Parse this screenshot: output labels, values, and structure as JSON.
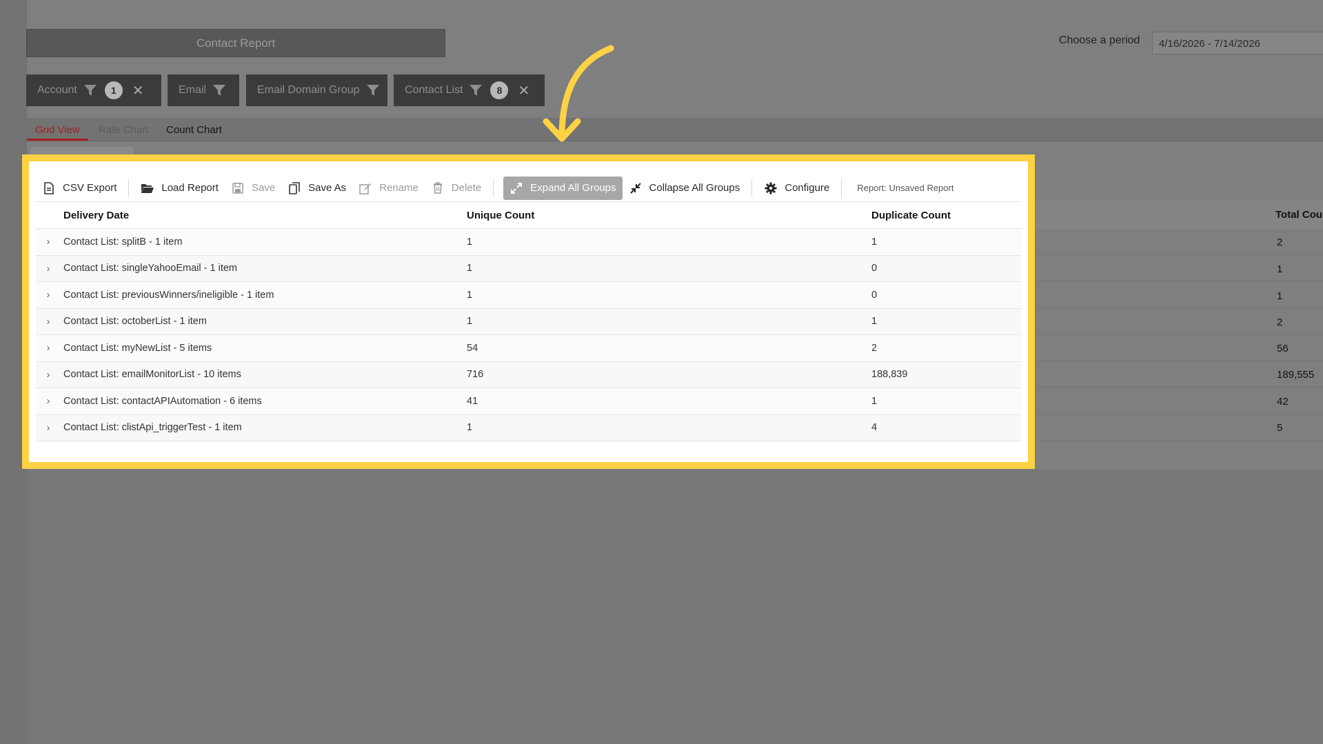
{
  "header": {
    "title": "Contact Report",
    "period_label": "Choose a period",
    "period_value": "4/16/2026 - 7/14/2026"
  },
  "filters": [
    {
      "label": "Account",
      "badge": "1",
      "removable": true
    },
    {
      "label": "Email",
      "badge": null,
      "removable": false
    },
    {
      "label": "Email Domain Group",
      "badge": null,
      "removable": false
    },
    {
      "label": "Contact List",
      "badge": "8",
      "removable": true
    }
  ],
  "filter_icons": {
    "funnel": "filter-funnel-icon",
    "remove": "close-icon",
    "remove_glyph": "✕"
  },
  "tabs": [
    {
      "label": "Grid View",
      "active": true
    },
    {
      "label": "Rate Chart",
      "active": false
    },
    {
      "label": "Count Chart",
      "active": false
    }
  ],
  "toolbar": {
    "csv_export": "CSV Export",
    "load_report": "Load Report",
    "save": "Save",
    "save_as": "Save As",
    "rename": "Rename",
    "delete": "Delete",
    "expand_all": "Expand All Groups",
    "collapse_all": "Collapse All Groups",
    "configure": "Configure",
    "report_name": "Report: Unsaved Report"
  },
  "grid": {
    "columns": {
      "delivery_date": "Delivery Date",
      "unique_count": "Unique Count",
      "duplicate_count": "Duplicate Count",
      "total_count": "Total Cou"
    },
    "rows": [
      {
        "name": "Contact List: splitB - 1 item",
        "unique": "1",
        "duplicate": "1",
        "total": "2"
      },
      {
        "name": "Contact List: singleYahooEmail - 1 item",
        "unique": "1",
        "duplicate": "0",
        "total": "1"
      },
      {
        "name": "Contact List: previousWinners/ineligible - 1 item",
        "unique": "1",
        "duplicate": "0",
        "total": "1"
      },
      {
        "name": "Contact List: octoberList - 1 item",
        "unique": "1",
        "duplicate": "1",
        "total": "2"
      },
      {
        "name": "Contact List: myNewList - 5 items",
        "unique": "54",
        "duplicate": "2",
        "total": "56"
      },
      {
        "name": "Contact List: emailMonitorList - 10 items",
        "unique": "716",
        "duplicate": "188,839",
        "total": "189,555"
      },
      {
        "name": "Contact List: contactAPIAutomation - 6 items",
        "unique": "41",
        "duplicate": "1",
        "total": "42"
      },
      {
        "name": "Contact List: clistApi_triggerTest - 1 item",
        "unique": "1",
        "duplicate": "4",
        "total": "5"
      }
    ],
    "expander_glyph": "›"
  },
  "colors": {
    "highlight": "#fdd243",
    "active_tab": "#a31f1f",
    "arrow": "#fdd243"
  }
}
